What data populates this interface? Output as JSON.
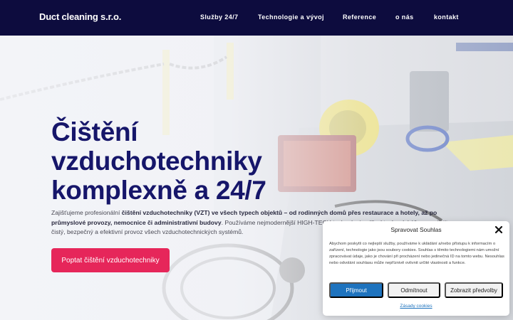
{
  "header": {
    "logo": "Duct cleaning s.r.o.",
    "nav": [
      "Služby 24/7",
      "Technologie a vývoj",
      "Reference",
      "o nás",
      "kontakt"
    ]
  },
  "hero": {
    "title_lines": [
      "Čištění",
      "vzduchotechniky",
      "komplexně a 24/7"
    ],
    "text_intro": "Zajišťujeme profesionální ",
    "text_bold": "čištění vzduchotechniky (VZT) ve všech typech objektů – od rodinných domů přes restaurace a hotely, až po průmyslové provozy, nemocnice či administrativní budovy",
    "text_rest": ". Používáme nejmodernější HIGH-TECH technologie, díky kterým dokážeme zajistit čistý, bezpečný a efektivní provoz všech vzduchotechnických systémů.",
    "cta_label": "Poptat čištění vzduchotechniky"
  },
  "cookie": {
    "title": "Spravovat Souhlas",
    "body": "Abychom poskytli co nejlepší služby, používáme k ukládání a/nebo přístupu k informacím o zařízení, technologie jako jsou soubory cookies. Souhlas s těmito technologiemi nám umožní zpracovávat údaje, jako je chování při procházení nebo jedinečná ID na tomto webu. Nesouhlas nebo odvolání souhlasu může nepříznivě ovlivnit určité vlastnosti a funkce.",
    "accept": "Přijmout",
    "deny": "Odmítnout",
    "preferences": "Zobrazit předvolby",
    "policy_link": "Zásady cookies"
  },
  "colors": {
    "header_bg": "#0d0c3e",
    "title": "#16166a",
    "cta": "#e6265a",
    "cookie_primary": "#1e73be"
  },
  "icons": [
    "close-icon"
  ]
}
